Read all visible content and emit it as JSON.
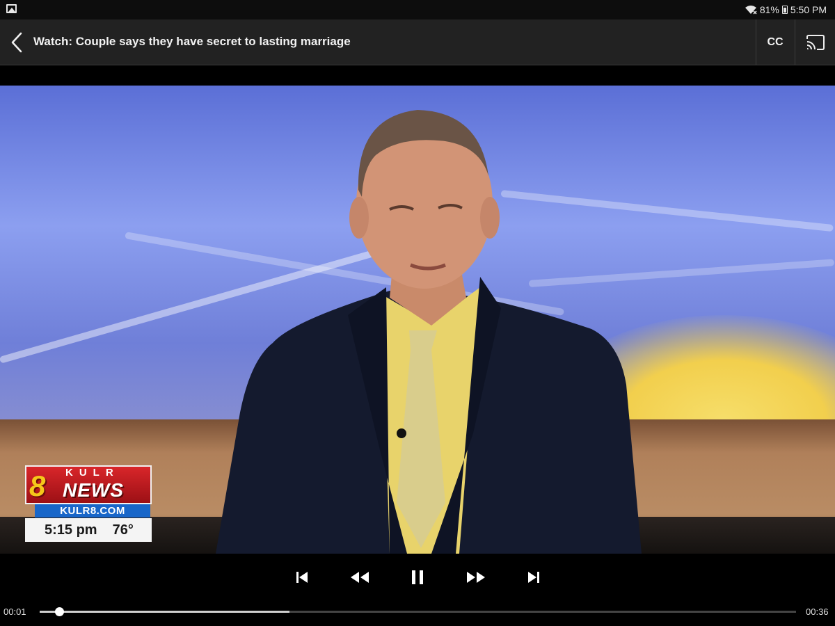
{
  "status_bar": {
    "battery": "81%",
    "time": "5:50 PM"
  },
  "app_bar": {
    "title": "Watch: Couple says they have secret to lasting marriage",
    "cc_label": "CC"
  },
  "video": {
    "channel_letters": "KULR",
    "channel_number": "8",
    "channel_brand": "NEWS",
    "website": "KULR8.COM",
    "clock": "5:15 pm",
    "temperature": "76°"
  },
  "player": {
    "current_time": "00:01",
    "duration": "00:36",
    "played_fraction": 0.026,
    "buffered_fraction": 0.33,
    "state": "playing"
  },
  "icons": {
    "back": "chevron-left-icon",
    "cast": "cast-icon",
    "signal": "wifi-icon",
    "battery": "battery-icon",
    "previous": "skip-previous-icon",
    "rewind": "rewind-icon",
    "pause": "pause-icon",
    "fast_forward": "fast-forward-icon",
    "next": "skip-next-icon"
  }
}
